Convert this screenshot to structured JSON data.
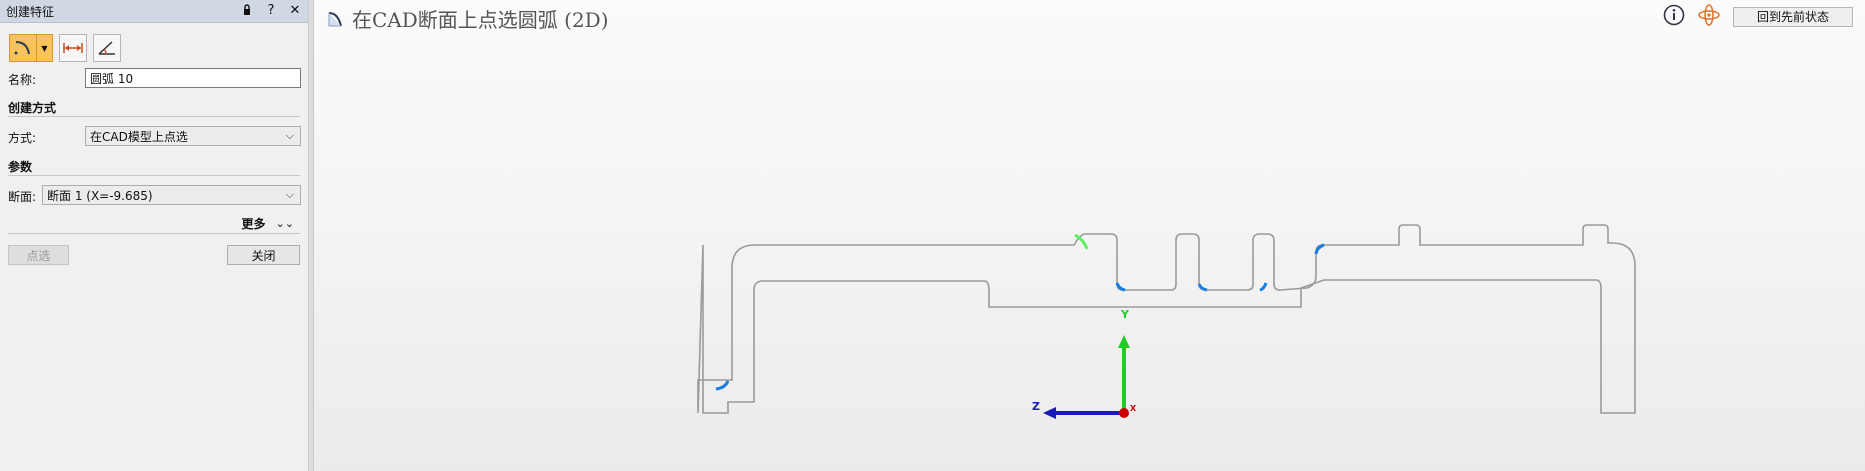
{
  "panel": {
    "title": "创建特征",
    "name_label": "名称:",
    "name_value": "圆弧 10",
    "section_create": "创建方式",
    "method_label": "方式:",
    "method_value": "在CAD模型上点选",
    "section_params": "参数",
    "section_label": "断面:",
    "section_value": "断面 1 (X=-9.685)",
    "more_label": "更多",
    "pick_button": "点选",
    "close_button": "关闭"
  },
  "viewport": {
    "title": "在CAD断面上点选圆弧 (2D)",
    "reset_button": "回到先前状态"
  },
  "axes": {
    "y_label": "Y",
    "z_label": "Z",
    "x_label": "X",
    "y_color": "#22cc22",
    "z_color": "#1a1ab8",
    "x_color": "#cc0000"
  },
  "colors": {
    "accent": "#f7c35a",
    "highlight_arc": "#1a7de0",
    "selected_arc": "#5ff05f",
    "profile_line": "#9a9a9a"
  }
}
